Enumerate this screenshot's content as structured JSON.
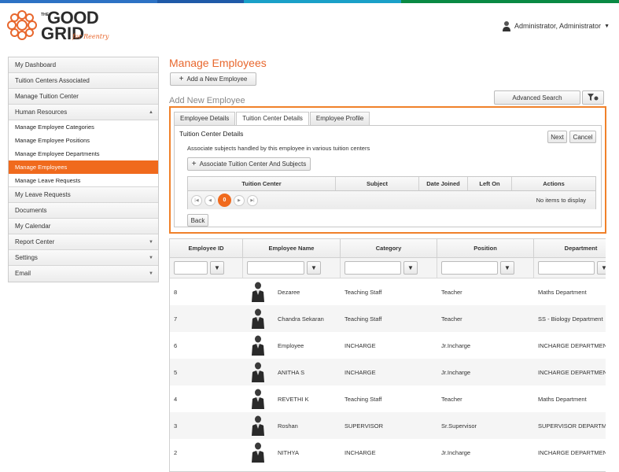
{
  "colors": {
    "accent": "#f06a1d",
    "panel_border": "#f0812a",
    "title": "#e8672d",
    "strip": [
      "#2d72c4",
      "#1aa0c8",
      "#0a8a44",
      "#1f5aa8"
    ]
  },
  "logo": {
    "the": "THE",
    "line1": "GOOD",
    "line2": "GRID",
    "tag": "for Reentry"
  },
  "user": {
    "name": "Administrator, Administrator"
  },
  "sidebar": {
    "items": [
      {
        "label": "My Dashboard"
      },
      {
        "label": "Tuition Centers Associated"
      },
      {
        "label": "Manage Tuition Center"
      },
      {
        "label": "Human Resources"
      },
      {
        "label": "Manage Employee Categories"
      },
      {
        "label": "Manage Employee Positions"
      },
      {
        "label": "Manage Employee Departments"
      },
      {
        "label": "Manage Employees"
      },
      {
        "label": "Manage Leave Requests"
      },
      {
        "label": "My Leave Requests"
      },
      {
        "label": "Documents"
      },
      {
        "label": "My Calendar"
      },
      {
        "label": "Report Center"
      },
      {
        "label": "Settings"
      },
      {
        "label": "Email"
      }
    ]
  },
  "main": {
    "title": "Manage Employees",
    "add_button": "Add a New Employee",
    "section_title": "Add New Employee",
    "advanced_search": "Advanced Search",
    "tabs": [
      {
        "label": "Employee Details"
      },
      {
        "label": "Tuition Center Details"
      },
      {
        "label": "Employee Profile"
      }
    ],
    "tab_title": "Tuition Center Details",
    "next": "Next",
    "cancel": "Cancel",
    "description": "Associate subjects handled by this employee in various tuition centers",
    "assoc_button": "Associate Tuition Center And Subjects",
    "assoc_grid": {
      "columns": [
        "Tuition Center",
        "Subject",
        "Date Joined",
        "Left On",
        "Actions"
      ],
      "current_page": "0",
      "empty": "No items to display"
    },
    "back": "Back"
  },
  "employees": {
    "columns": [
      "Employee ID",
      "Employee Name",
      "Category",
      "Position",
      "Department"
    ],
    "rows": [
      {
        "id": "8",
        "name": "Dezaree",
        "category": "Teaching Staff",
        "position": "Teacher",
        "department": "Maths Department"
      },
      {
        "id": "7",
        "name": "Chandra Sekaran",
        "category": "Teaching Staff",
        "position": "Teacher",
        "department": "SS - Biology Department"
      },
      {
        "id": "6",
        "name": "Employee",
        "category": "INCHARGE",
        "position": "Jr.Incharge",
        "department": "INCHARGE DEPARTMENT"
      },
      {
        "id": "5",
        "name": "ANITHA S",
        "category": "INCHARGE",
        "position": "Jr.Incharge",
        "department": "INCHARGE DEPARTMENT"
      },
      {
        "id": "4",
        "name": "REVETHI K",
        "category": "Teaching Staff",
        "position": "Teacher",
        "department": "Maths Department"
      },
      {
        "id": "3",
        "name": "Roshan",
        "category": "SUPERVISOR",
        "position": "Sr.Supervisor",
        "department": "SUPERVISOR DEPARTMENT"
      },
      {
        "id": "2",
        "name": "NITHYA",
        "category": "INCHARGE",
        "position": "Jr.Incharge",
        "department": "INCHARGE DEPARTMENT"
      }
    ]
  }
}
